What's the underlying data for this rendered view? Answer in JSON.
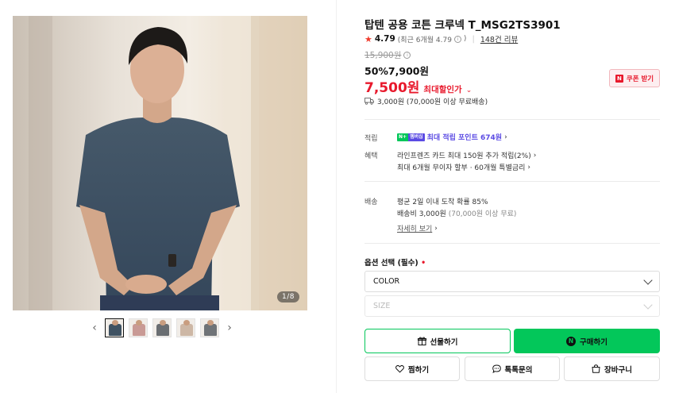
{
  "gallery": {
    "page_indicator": "1/8",
    "prev_icon": "chevron-left-icon",
    "next_icon": "chevron-right-icon",
    "thumbnail_colors": [
      "#3f5262",
      "#c99a95",
      "#6a6e72",
      "#cdb7a5",
      "#6f7377"
    ]
  },
  "product": {
    "title": "탑텐 공용 코튼 크루넥 T_MSG2TS3901",
    "rating": "4.79",
    "rating_detail": "(최근 6개월 4.79",
    "rating_detail_close": ")",
    "review_count": "148건 리뷰",
    "original_price": "15,900원",
    "discount_rate": "50%",
    "sale_price": "7,900원",
    "max_discount_price": "7,500원",
    "max_discount_label": "최대할인가",
    "coupon_button": "쿠폰 받기",
    "delivery_fee": "3,000원 (70,000원 이상 무료배송)"
  },
  "benefits": {
    "point_label": "적립",
    "point_badge_n": "N+",
    "point_badge_m": "멤버십",
    "point_text": "최대 적립 포인트 674원",
    "benefit_label": "혜택",
    "benefit_line1": "라인프렌즈 카드 최대 150원 추가 적립(2%)",
    "benefit_line2": "최대 6개월 무이자 할부 · 60개월 특별금리"
  },
  "shipping": {
    "label": "배송",
    "line1": "평균 2일 이내 도착 확률 85%",
    "line2_main": "배송비 3,000원",
    "line2_sub": "(70,000원 이상 무료)",
    "detail_link": "자세히 보기"
  },
  "options": {
    "label": "옵션 선택 (필수)",
    "required_mark": "•",
    "color_select": "COLOR",
    "size_select": "SIZE"
  },
  "actions": {
    "gift": "선물하기",
    "buy": "구매하기",
    "buy_badge": "N",
    "wish": "찜하기",
    "talk": "톡톡문의",
    "cart": "장바구니"
  },
  "colors": {
    "accent_red": "#e8192c",
    "naver_green": "#03c75a",
    "membership_purple": "#5b4be3"
  }
}
